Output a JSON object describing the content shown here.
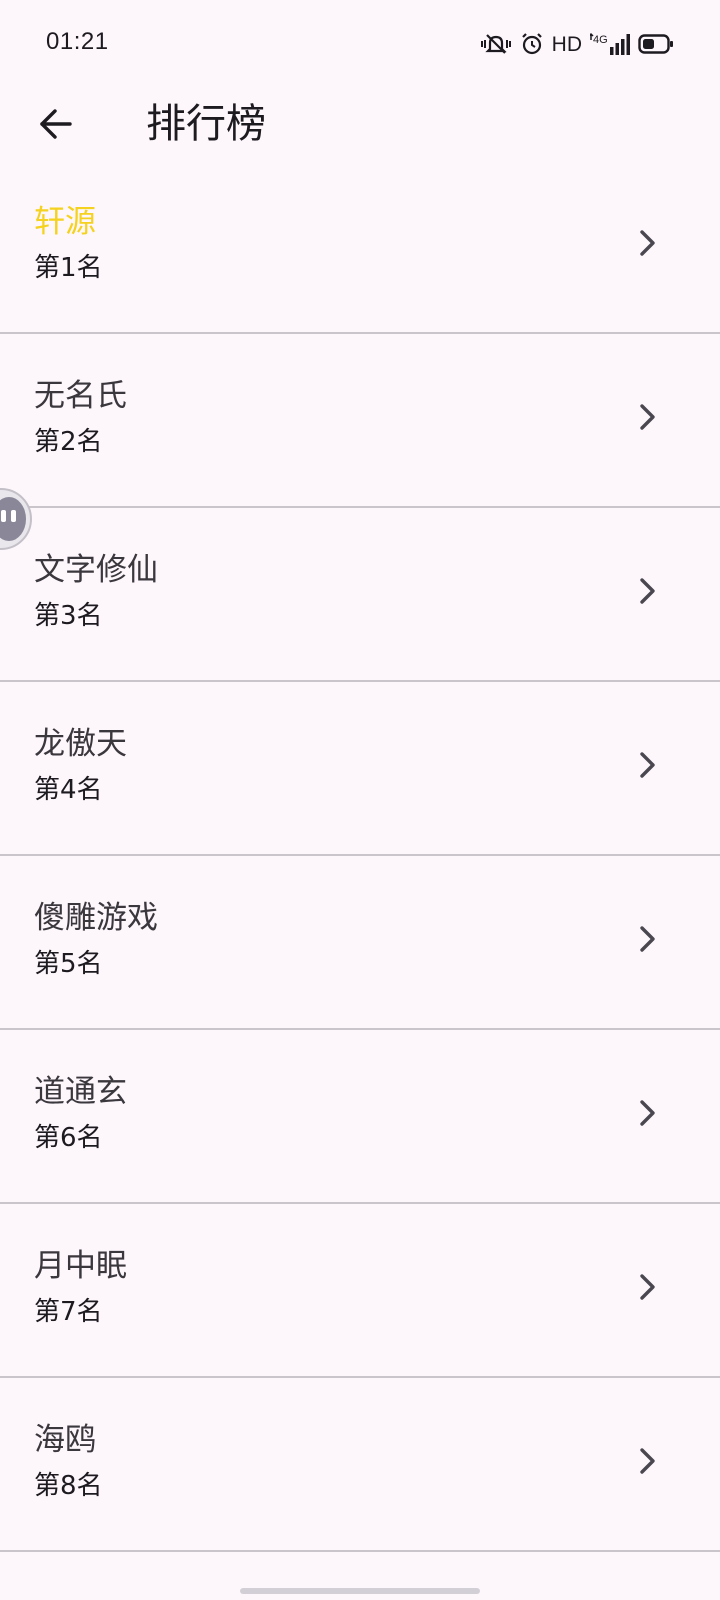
{
  "status_bar": {
    "time": "01:21",
    "hd_label": "HD",
    "network_label": "4G",
    "icons": [
      "vibrate-mute-icon",
      "alarm-icon",
      "hd-icon",
      "4g-signal-icon",
      "battery-icon"
    ]
  },
  "app_bar": {
    "back_icon": "arrow-left-icon",
    "title": "排行榜"
  },
  "leaderboard": {
    "items": [
      {
        "name": "轩源",
        "rank": "第1名",
        "highlight": true
      },
      {
        "name": "无名氏",
        "rank": "第2名"
      },
      {
        "name": "文字修仙",
        "rank": "第3名"
      },
      {
        "name": "龙傲天",
        "rank": "第4名"
      },
      {
        "name": "傻雕游戏",
        "rank": "第5名"
      },
      {
        "name": "道通玄",
        "rank": "第6名"
      },
      {
        "name": "月中眠",
        "rank": "第7名"
      },
      {
        "name": "海鸥",
        "rank": "第8名"
      }
    ],
    "chevron_icon": "chevron-right-icon"
  },
  "colors": {
    "background": "#fdf7fc",
    "first_place": "#f5d21f",
    "divider": "#c9c5ca",
    "text": "#1d1b20"
  }
}
